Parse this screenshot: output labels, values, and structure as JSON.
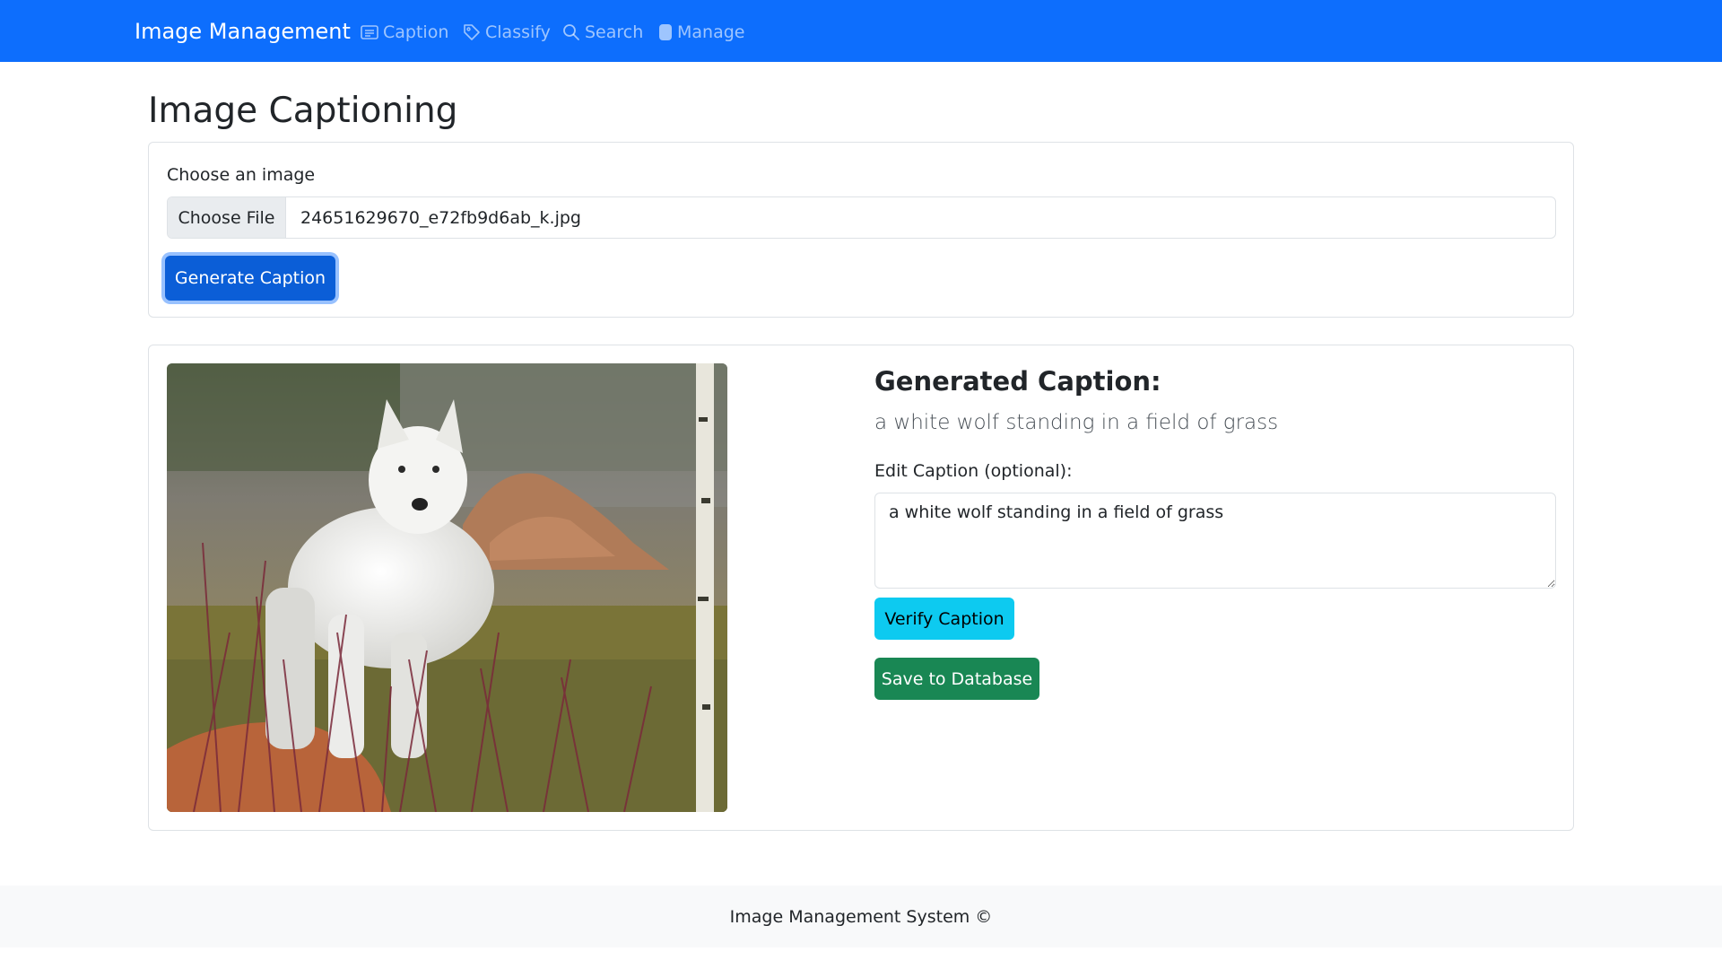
{
  "navbar": {
    "brand": "Image Management",
    "items": [
      {
        "label": "Caption",
        "icon": "card-text-icon"
      },
      {
        "label": "Classify",
        "icon": "tag-icon"
      },
      {
        "label": "Search",
        "icon": "search-icon"
      },
      {
        "label": "Manage",
        "icon": "database-icon"
      }
    ]
  },
  "page": {
    "title": "Image Captioning"
  },
  "upload": {
    "label": "Choose an image",
    "choose_button": "Choose File",
    "file_name": "24651629670_e72fb9d6ab_k.jpg",
    "generate_button": "Generate Caption"
  },
  "result": {
    "image_description_icon": "wolf-photo",
    "heading": "Generated Caption:",
    "caption": "a white wolf standing in a field of grass",
    "edit_label": "Edit Caption (optional):",
    "edit_value": "a white wolf standing in a field of grass",
    "verify_button": "Verify Caption",
    "save_button": "Save to Database"
  },
  "footer": {
    "text": "Image Management System ©"
  },
  "colors": {
    "primary": "#0d6efd",
    "info": "#0dcaf0",
    "success": "#198754"
  }
}
